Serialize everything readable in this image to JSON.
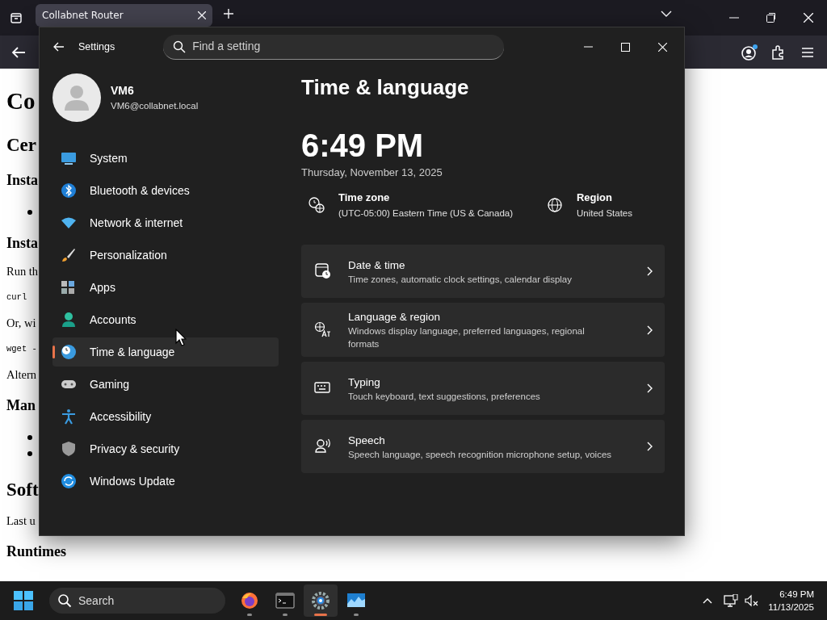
{
  "browser": {
    "tabs": [
      {
        "title": "Collabnet Router",
        "selected": true
      }
    ],
    "page_lines": [
      {
        "kind": "h1",
        "text": "Co"
      },
      {
        "kind": "h2",
        "text": "Cer"
      },
      {
        "kind": "h3",
        "text": "Insta"
      },
      {
        "kind": "bullet"
      },
      {
        "kind": "h3",
        "text": "Insta"
      },
      {
        "kind": "p",
        "text": "Run th"
      },
      {
        "kind": "code",
        "text": "curl"
      },
      {
        "kind": "p",
        "text": "Or, wi"
      },
      {
        "kind": "code",
        "text": "wget -"
      },
      {
        "kind": "p",
        "text": "Altern"
      },
      {
        "kind": "h3",
        "text": "Man"
      },
      {
        "kind": "bullet"
      },
      {
        "kind": "bullet2"
      },
      {
        "kind": "h2",
        "text": "Soft"
      },
      {
        "kind": "p",
        "text": "Last u"
      },
      {
        "kind": "h3",
        "text": "Runtimes"
      }
    ]
  },
  "settings": {
    "title": "Settings",
    "search": {
      "placeholder": "Find a setting"
    },
    "user": {
      "name": "VM6",
      "email": "VM6@collabnet.local"
    },
    "nav": [
      {
        "label": "System",
        "selected": false
      },
      {
        "label": "Bluetooth & devices",
        "selected": false
      },
      {
        "label": "Network & internet",
        "selected": false
      },
      {
        "label": "Personalization",
        "selected": false
      },
      {
        "label": "Apps",
        "selected": false
      },
      {
        "label": "Accounts",
        "selected": false
      },
      {
        "label": "Time & language",
        "selected": true
      },
      {
        "label": "Gaming",
        "selected": false
      },
      {
        "label": "Accessibility",
        "selected": false
      },
      {
        "label": "Privacy & security",
        "selected": false
      },
      {
        "label": "Windows Update",
        "selected": false
      }
    ],
    "page_title": "Time & language",
    "clock": "6:49 PM",
    "date": "Thursday, November 13, 2025",
    "info": [
      {
        "label": "Time zone",
        "value": "(UTC-05:00) Eastern Time (US & Canada)"
      },
      {
        "label": "Region",
        "value": "United States"
      }
    ],
    "cards": [
      {
        "title": "Date & time",
        "subtitle": "Time zones, automatic clock settings, calendar display"
      },
      {
        "title": "Language & region",
        "subtitle": "Windows display language, preferred languages, regional formats"
      },
      {
        "title": "Typing",
        "subtitle": "Touch keyboard, text suggestions, preferences"
      },
      {
        "title": "Speech",
        "subtitle": "Speech language, speech recognition microphone setup, voices"
      }
    ]
  },
  "taskbar": {
    "search": {
      "placeholder": "Search"
    },
    "apps": [
      {
        "selected": false
      },
      {
        "selected": false
      },
      {
        "selected": true
      },
      {
        "selected": false
      }
    ],
    "time": "6:49 PM",
    "date": "11/13/2025"
  }
}
